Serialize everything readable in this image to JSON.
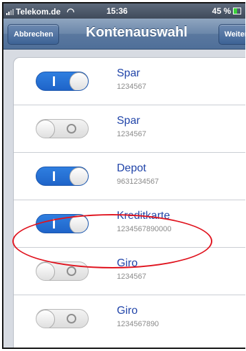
{
  "status_bar": {
    "carrier": "Telekom.de",
    "time": "15:36",
    "battery": "45 %"
  },
  "navbar": {
    "left_button": "Abbrechen",
    "title": "Kontenauswahl",
    "right_button": "Weiter"
  },
  "accounts": [
    {
      "name": "Spar",
      "number": "1234567",
      "enabled": true
    },
    {
      "name": "Spar",
      "number": "1234567",
      "enabled": false
    },
    {
      "name": "Depot",
      "number": "9631234567",
      "enabled": true
    },
    {
      "name": "Kreditkarte",
      "number": "1234567890000",
      "enabled": true
    },
    {
      "name": "Giro",
      "number": "1234567",
      "enabled": false
    },
    {
      "name": "Giro",
      "number": "1234567890",
      "enabled": false
    }
  ],
  "colors": {
    "toggle_on": "#1f64c9",
    "name_text": "#1f43a8",
    "highlight": "#e0141f"
  }
}
